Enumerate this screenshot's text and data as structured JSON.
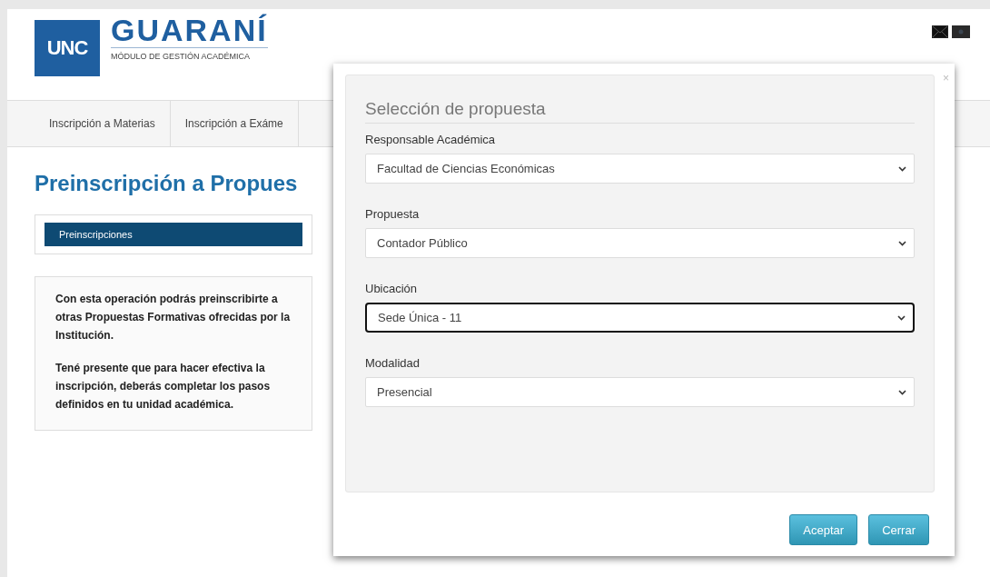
{
  "header": {
    "logo_badge": "UNC",
    "logo_title": "GUARANÍ",
    "logo_subtitle": "MÓDULO DE GESTIÓN ACADÉMICA"
  },
  "nav": {
    "items": [
      {
        "label": "Inscripción a Materias"
      },
      {
        "label": "Inscripción a Exáme"
      }
    ]
  },
  "page_title": "Preinscripción a Propues",
  "sidebar": {
    "items": [
      {
        "label": "Preinscripciones",
        "selected": true
      }
    ]
  },
  "info": {
    "paragraphs": [
      "Con esta operación podrás preinscribirte a otras Propuestas Formativas ofrecidas por la Institución.",
      "Tené presente que para hacer efectiva la inscripción, deberás completar los pasos definidos en tu unidad académica."
    ]
  },
  "modal": {
    "title": "Selección de propuesta",
    "close": "×",
    "fields": [
      {
        "label": "Responsable Académica",
        "value": "Facultad de Ciencias Económicas",
        "focused": false
      },
      {
        "label": "Propuesta",
        "value": "Contador Público",
        "focused": false
      },
      {
        "label": "Ubicación",
        "value": "Sede Única - 11",
        "focused": true
      },
      {
        "label": "Modalidad",
        "value": "Presencial",
        "focused": false
      }
    ],
    "buttons": [
      {
        "label": "Aceptar"
      },
      {
        "label": "Cerrar"
      }
    ]
  }
}
